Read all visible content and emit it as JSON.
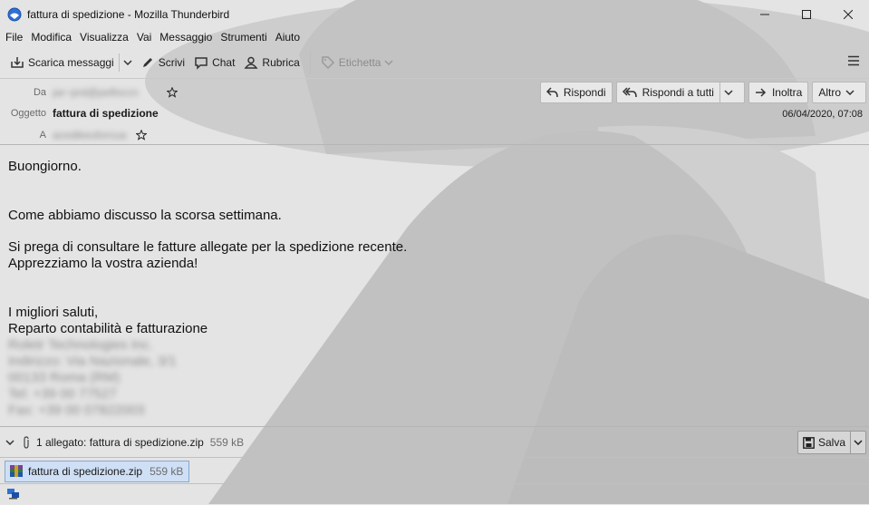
{
  "window": {
    "title": "fattura di spedizione - Mozilla Thunderbird",
    "minimize_icon": "minimize-icon",
    "maximize_icon": "maximize-icon",
    "close_icon": "close-icon"
  },
  "menubar": {
    "items": [
      "File",
      "Modifica",
      "Visualizza",
      "Vai",
      "Messaggio",
      "Strumenti",
      "Aiuto"
    ]
  },
  "toolbar": {
    "get_messages": "Scarica messaggi",
    "write": "Scrivi",
    "chat": "Chat",
    "address_book": "Rubrica",
    "tag": "Etichetta",
    "menu_icon": "hamburger-menu-icon"
  },
  "header": {
    "from_label": "Da",
    "from_value": "pe~prd@pelfoccn",
    "subject_label": "Oggetto",
    "subject_value": "fattura di spedizione",
    "to_label": "A",
    "to_value": "acedikeuforcua",
    "date": "06/04/2020, 07:08",
    "reply": "Rispondi",
    "reply_all": "Rispondi a tutti",
    "forward": "Inoltra",
    "more": "Altro"
  },
  "body": {
    "lines": [
      "Buongiorno.",
      "Come abbiamo discusso la scorsa settimana.",
      "Si prega di consultare le fatture allegate per la spedizione recente.",
      "Apprezziamo la vostra azienda!",
      "I migliori saluti,",
      "Reparto contabilità e fatturazione"
    ],
    "signature_blurred": [
      "Roletr Technologies Inc.",
      "Indirizzo: Via Nazionale, 3/1",
      "00133 Roma (RM)",
      "Tel: +39 00 77527",
      "Fax: +39 00 07822003"
    ]
  },
  "attachments": {
    "summary": "1 allegato: fattura di spedizione.zip",
    "summary_size": "559 kB",
    "save": "Salva",
    "file_name": "fattura di spedizione.zip",
    "file_size": "559 kB"
  },
  "colors": {
    "selection": "#ccdef6",
    "thunderbird_blue": "#2f6fd6"
  }
}
